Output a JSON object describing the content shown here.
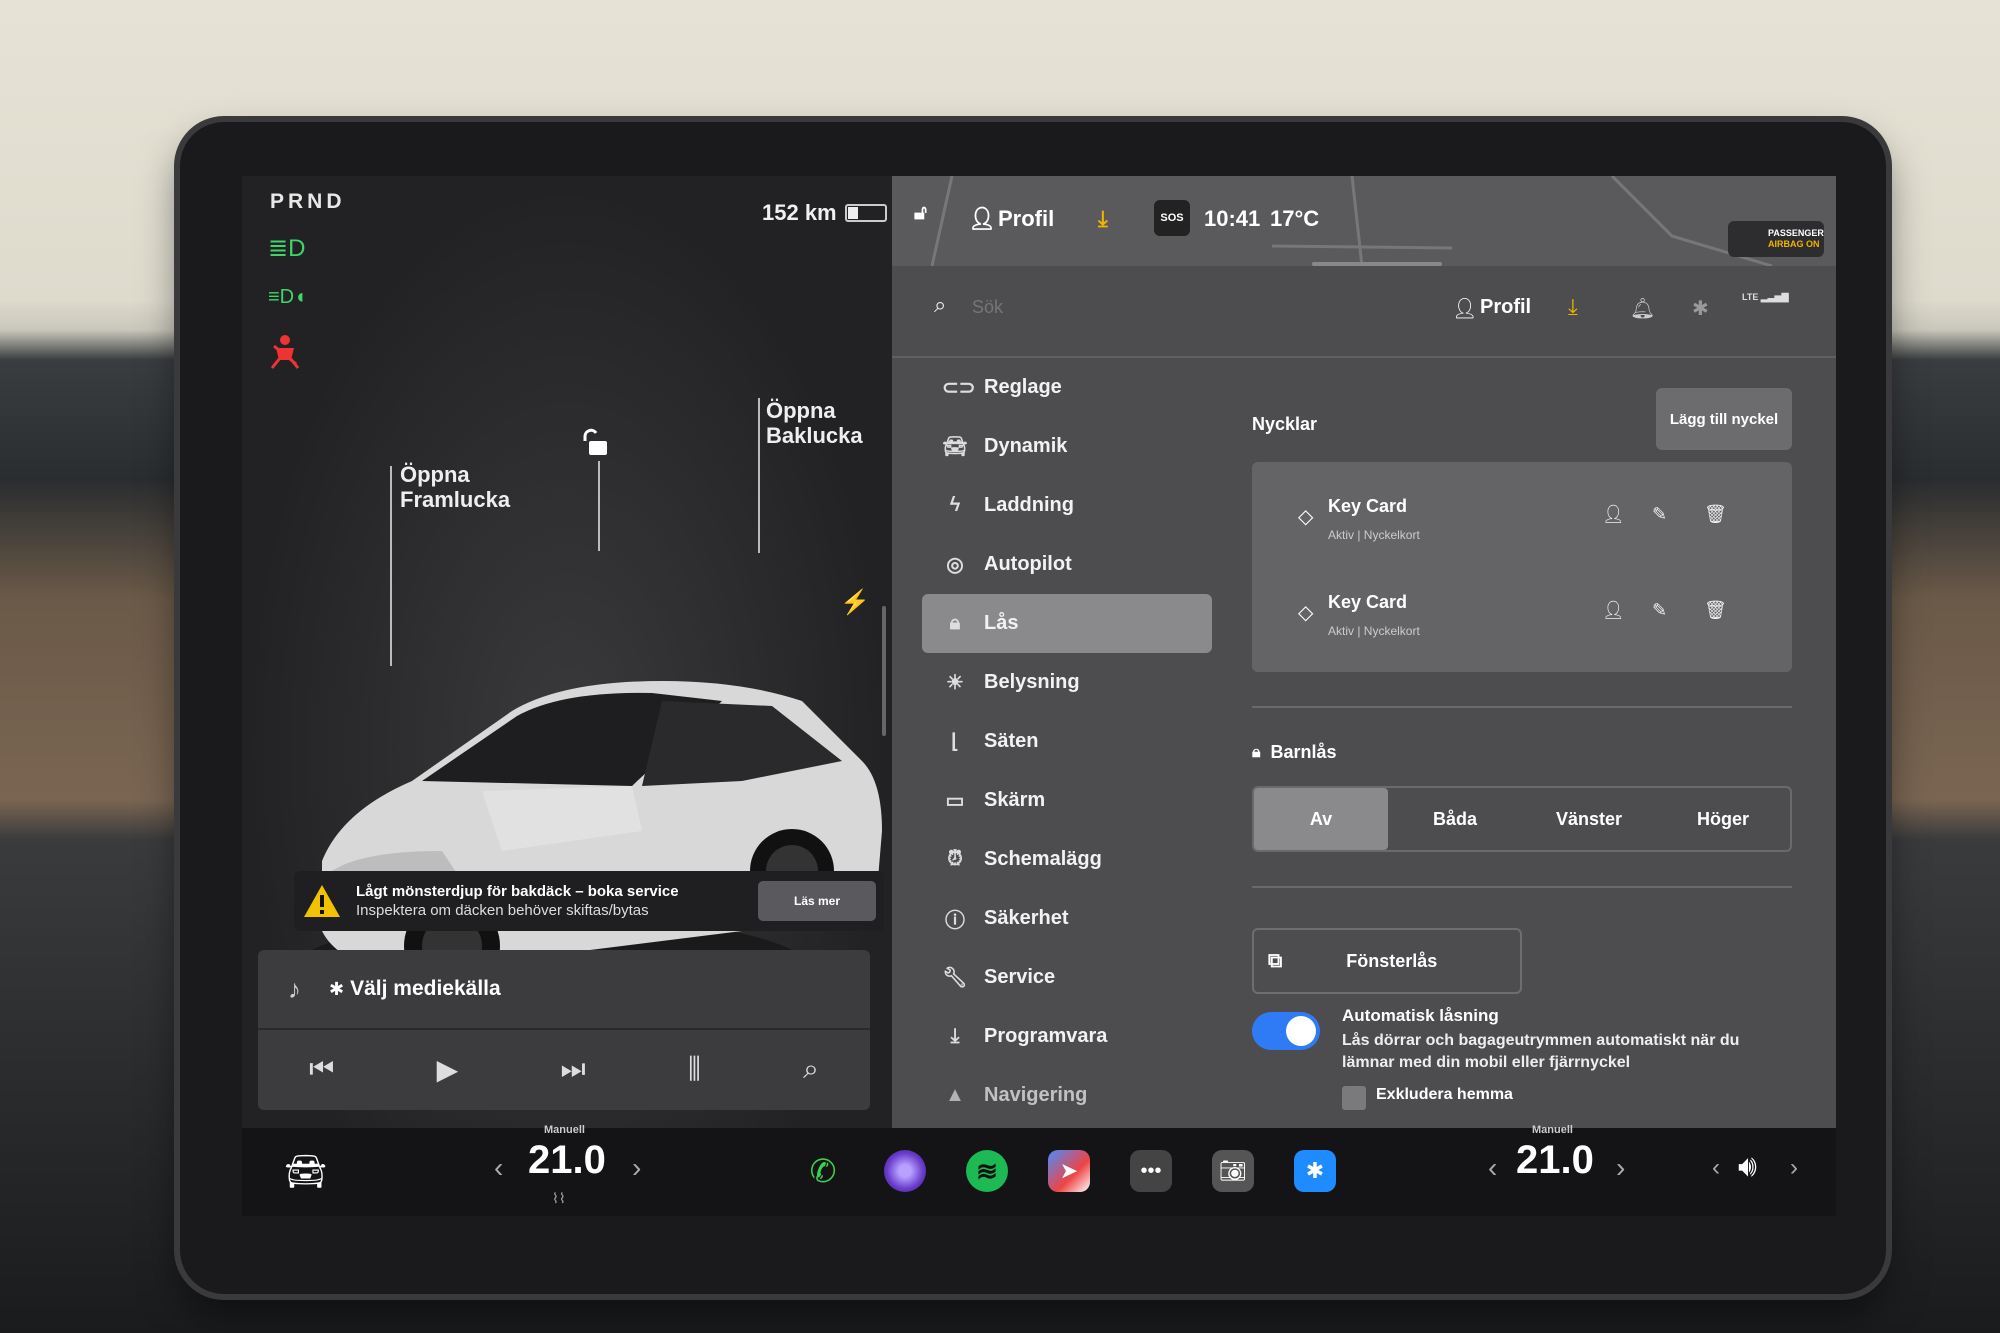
{
  "status": {
    "gear": "PRND",
    "range": "152 km",
    "time": "10:41",
    "outside_temp": "17°C",
    "profile": "Profil",
    "sos": "SOS",
    "airbag_line1": "PASSENGER",
    "airbag_line2": "AIRBAG ON"
  },
  "car_view": {
    "frunk_line1": "Öppna",
    "frunk_line2": "Framlucka",
    "trunk_line1": "Öppna",
    "trunk_line2": "Baklucka"
  },
  "alert": {
    "title": "Lågt mönsterdjup för bakdäck – boka service",
    "subtitle": "Inspektera om däcken behöver skiftas/bytas",
    "button": "Läs mer"
  },
  "media": {
    "source": "Välj mediekälla"
  },
  "search": {
    "placeholder": "Sök",
    "profile": "Profil",
    "lte": "LTE"
  },
  "menu": [
    {
      "label": "Reglage"
    },
    {
      "label": "Dynamik"
    },
    {
      "label": "Laddning"
    },
    {
      "label": "Autopilot"
    },
    {
      "label": "Lås"
    },
    {
      "label": "Belysning"
    },
    {
      "label": "Säten"
    },
    {
      "label": "Skärm"
    },
    {
      "label": "Schemalägg"
    },
    {
      "label": "Säkerhet"
    },
    {
      "label": "Service"
    },
    {
      "label": "Programvara"
    },
    {
      "label": "Navigering"
    }
  ],
  "locks": {
    "keys_heading": "Nycklar",
    "add_key": "Lägg till nyckel",
    "keys": [
      {
        "name": "Key Card",
        "status": "Aktiv | Nyckelkort"
      },
      {
        "name": "Key Card",
        "status": "Aktiv | Nyckelkort"
      }
    ],
    "child_lock_heading": "Barnlås",
    "child_lock_options": [
      "Av",
      "Båda",
      "Vänster",
      "Höger"
    ],
    "window_lock": "Fönsterlås",
    "auto_lock_title": "Automatisk låsning",
    "auto_lock_desc1": "Lås dörrar och bagageutrymmen automatiskt när du",
    "auto_lock_desc2": "lämnar med din mobil eller fjärrnyckel",
    "exclude_home": "Exkludera hemma"
  },
  "climate": {
    "left_mode": "Manuell",
    "left_temp": "21.0",
    "right_mode": "Manuell",
    "right_temp": "21.0"
  }
}
